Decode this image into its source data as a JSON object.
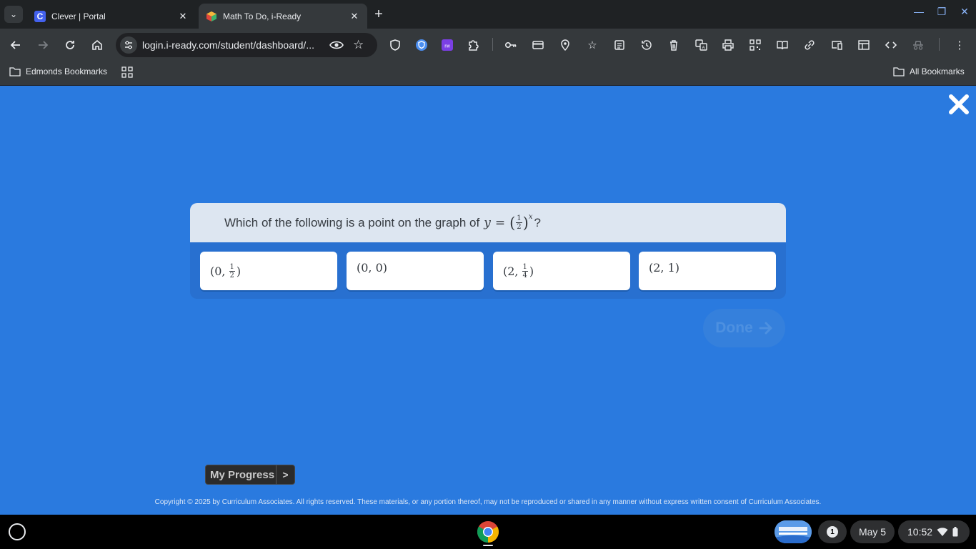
{
  "browser": {
    "tabs": [
      {
        "title": "Clever | Portal",
        "favicon": "clever-icon",
        "active": false
      },
      {
        "title": "Math To Do, i-Ready",
        "favicon": "iready-cube-icon",
        "active": true
      }
    ],
    "url": "login.i-ready.com/student/dashboard/...",
    "bookmarks": {
      "left_folder": "Edmonds Bookmarks",
      "right_folder": "All Bookmarks"
    }
  },
  "question": {
    "prompt": "Which of the following is a point on the graph of",
    "equation": {
      "lhs": "y",
      "equals": "=",
      "base_num": "1",
      "base_den": "2",
      "exponent": "x"
    },
    "qmark": "?",
    "choices": [
      {
        "prefix": "(0,",
        "num": "1",
        "den": "2",
        "suffix": ")"
      },
      {
        "text": "(0, 0)"
      },
      {
        "prefix": "(2,",
        "num": "1",
        "den": "4",
        "suffix": ")"
      },
      {
        "text": "(2, 1)"
      }
    ]
  },
  "done_label": "Done",
  "progress_label": "My Progress",
  "progress_arrow": ">",
  "copyright": "Copyright © 2025 by Curriculum Associates. All rights reserved. These materials, or any portion thereof, may not be reproduced or shared in any manner without express written consent of Curriculum Associates.",
  "shelf": {
    "notification_count": "1",
    "date": "May 5",
    "time": "10:52"
  },
  "colors": {
    "page_bg": "#2a7adf",
    "question_header_bg": "#dde6f1"
  }
}
